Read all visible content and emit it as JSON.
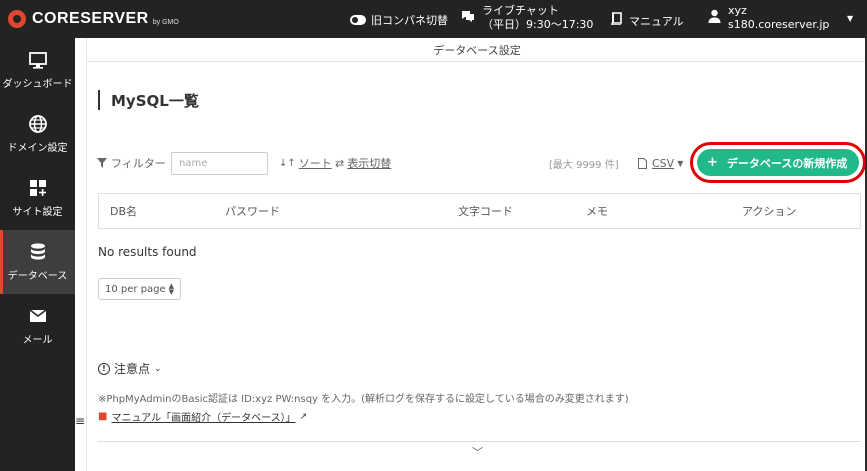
{
  "header": {
    "brand": "CORESERVER",
    "brand_sub": "by GMO",
    "old_panel_label": "旧コンパネ切替",
    "chat_title": "ライブチャット",
    "chat_hours": "（平日）9:30～17:30",
    "manual_label": "マニュアル",
    "user_name": "xyz",
    "user_server": "s180.coreserver.jp"
  },
  "sidebar": {
    "items": [
      {
        "label": "ダッシュボード",
        "icon": "monitor-icon"
      },
      {
        "label": "ドメイン設定",
        "icon": "globe-icon"
      },
      {
        "label": "サイト設定",
        "icon": "grid-plus-icon"
      },
      {
        "label": "データベース",
        "icon": "database-icon",
        "active": true
      },
      {
        "label": "メール",
        "icon": "mail-icon"
      }
    ]
  },
  "main": {
    "breadcrumb": "データベース設定",
    "title": "MySQL一覧",
    "filter_label": "フィルター",
    "filter_placeholder": "name",
    "sort_label": "ソート",
    "display_toggle_label": "表示切替",
    "max_note": "[最大 9999 件]",
    "csv_label": "CSV",
    "create_button": "データベースの新規作成",
    "columns": [
      "DB名",
      "パスワード",
      "文字コード",
      "メモ",
      "アクション"
    ],
    "empty_text": "No results found",
    "per_page": "10 per page",
    "notes_toggle": "注意点",
    "note_text": "※PhpMyAdminのBasic認証は ID:xyz PW:nsqy を入力。(解析ログを保存するに設定している場合のみ変更されます)",
    "manual_link": "マニュアル「画面紹介（データベース）」"
  },
  "colors": {
    "accent_green": "#21b98b",
    "brand_red": "#e0452e",
    "highlight_red": "#e00000",
    "header_bg": "#232323"
  }
}
